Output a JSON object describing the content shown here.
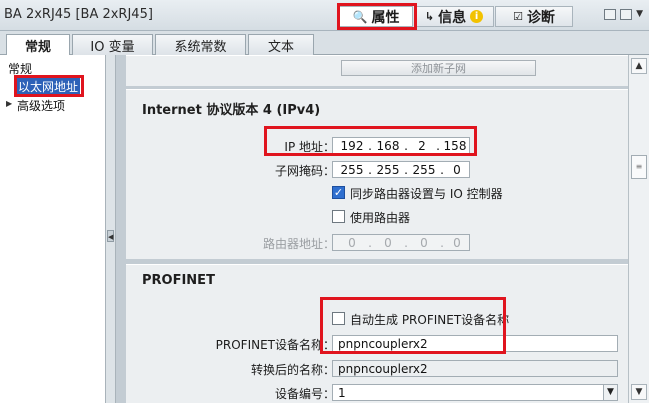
{
  "header": {
    "device_title": "BA 2xRJ45 [BA 2xRJ45]",
    "tabs": [
      {
        "label": "属性",
        "icon": "properties-icon"
      },
      {
        "label": "信息",
        "icon": "info-icon"
      },
      {
        "label": "诊断",
        "icon": "diagnostics-icon"
      }
    ]
  },
  "subtabs": [
    "常规",
    "IO 变量",
    "系统常数",
    "文本"
  ],
  "nav": {
    "items": [
      "常规",
      "以太网地址",
      "高级选项"
    ]
  },
  "add_subnet_label": "添加新子网",
  "ipv4": {
    "title": "Internet 协议版本 4 (IPv4)",
    "ip_label": "IP 地址：",
    "ip": [
      "192",
      "168",
      "2",
      "158"
    ],
    "mask_label": "子网掩码：",
    "mask": [
      "255",
      "255",
      "255",
      "0"
    ],
    "sync_router_label": "同步路由器设置与 IO 控制器",
    "sync_router_checked": true,
    "use_router_label": "使用路由器",
    "use_router_checked": false,
    "router_label": "路由器地址：",
    "router": [
      "0",
      "0",
      "0",
      "0"
    ]
  },
  "profinet": {
    "title": "PROFINET",
    "auto_name_label": "自动生成 PROFINET设备名称",
    "auto_name_checked": false,
    "device_name_label": "PROFINET设备名称：",
    "device_name": "pnpncouplerx2",
    "converted_label": "转换后的名称：",
    "converted_name": "pnpncouplerx2",
    "device_number_label": "设备编号：",
    "device_number": "1"
  },
  "colors": {
    "highlight_border": "#e0141e",
    "selection": "#2e62b8",
    "checkbox_checked": "#2f6fcf"
  }
}
